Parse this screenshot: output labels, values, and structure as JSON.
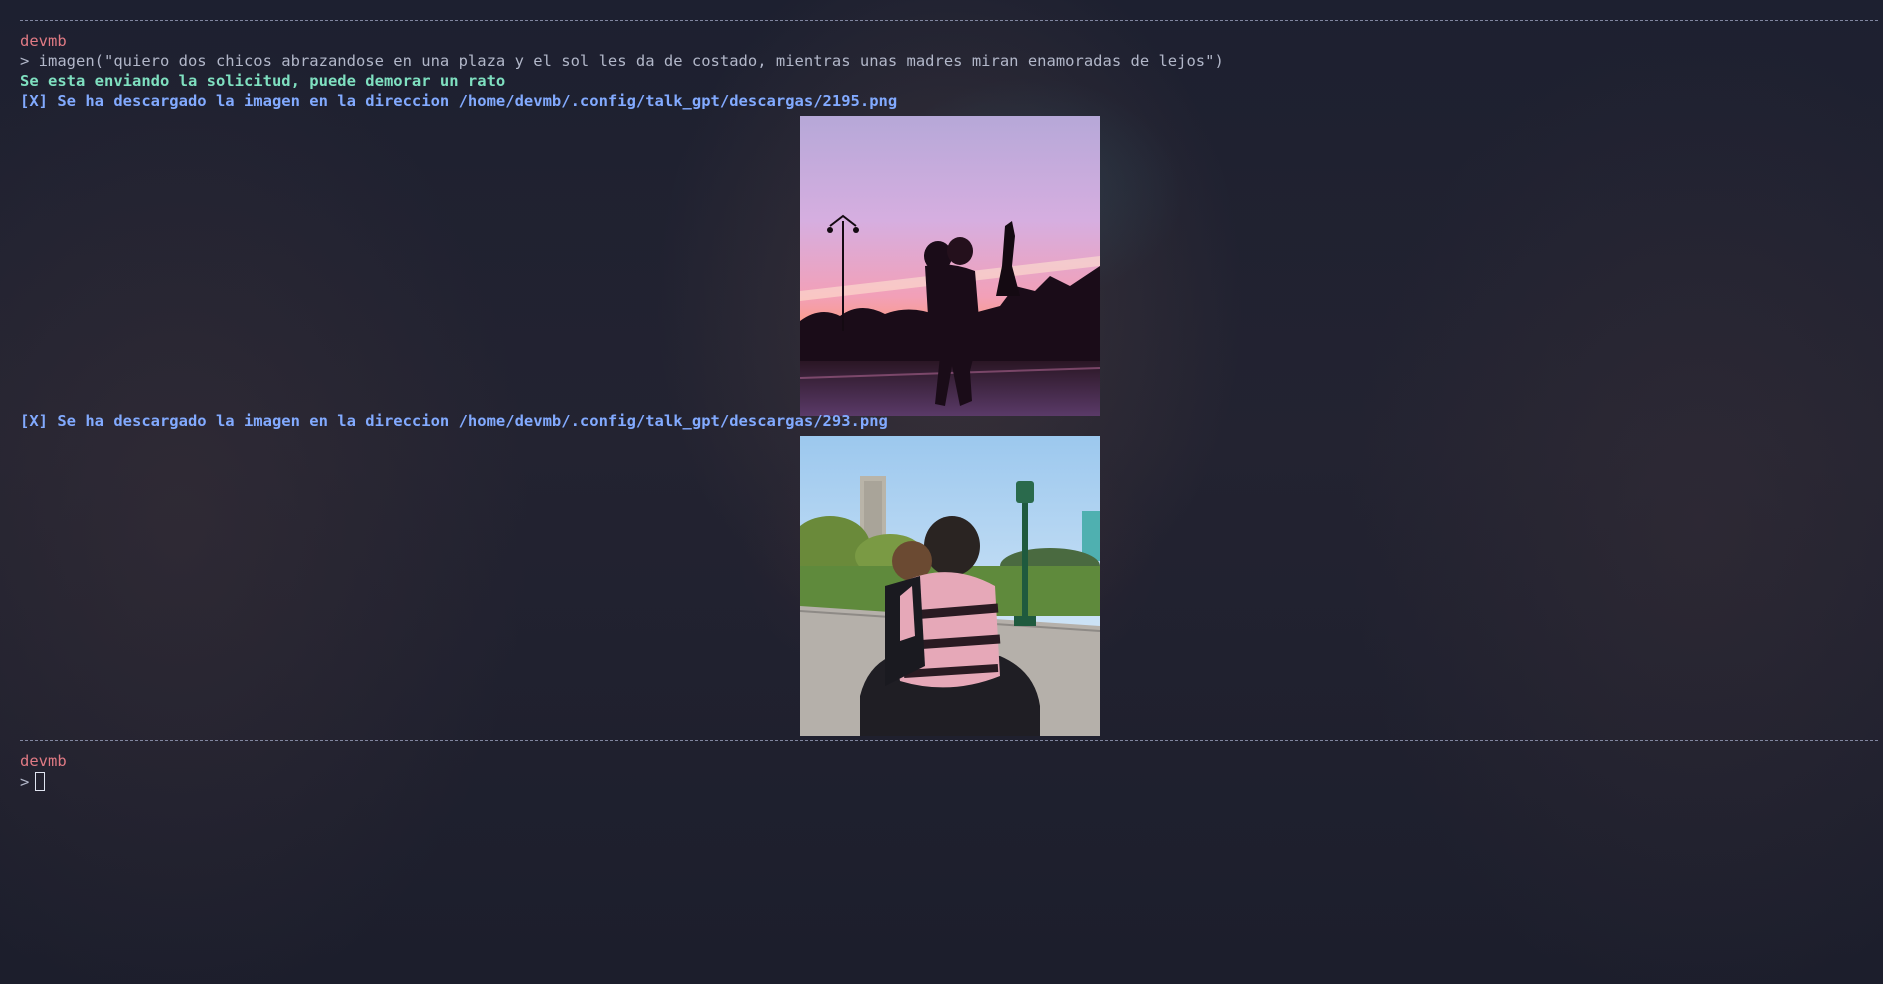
{
  "terminal": {
    "session1": {
      "user": "devmb",
      "command": "> imagen(\"quiero dos chicos abrazandose en una plaza y el sol les da de costado, mientras unas madres miran enamoradas de lejos\")",
      "status": "Se esta enviando la solicitud, puede demorar un rato",
      "downloads": [
        {
          "message": "[X] Se ha descargado la imagen en la direccion /home/devmb/.config/talk_gpt/descargas/2195.png",
          "image": "sunset-silhouette-hug-photo"
        },
        {
          "message": "[X] Se ha descargado la imagen en la direccion /home/devmb/.config/talk_gpt/descargas/293.png",
          "image": "park-hug-photo"
        }
      ]
    },
    "session2": {
      "user": "devmb",
      "prompt": ">"
    }
  },
  "colors": {
    "background": "#1b1e2b",
    "user": "#e07a84",
    "command": "#b2b7c9",
    "status": "#7fe0c0",
    "download": "#82aaff"
  }
}
